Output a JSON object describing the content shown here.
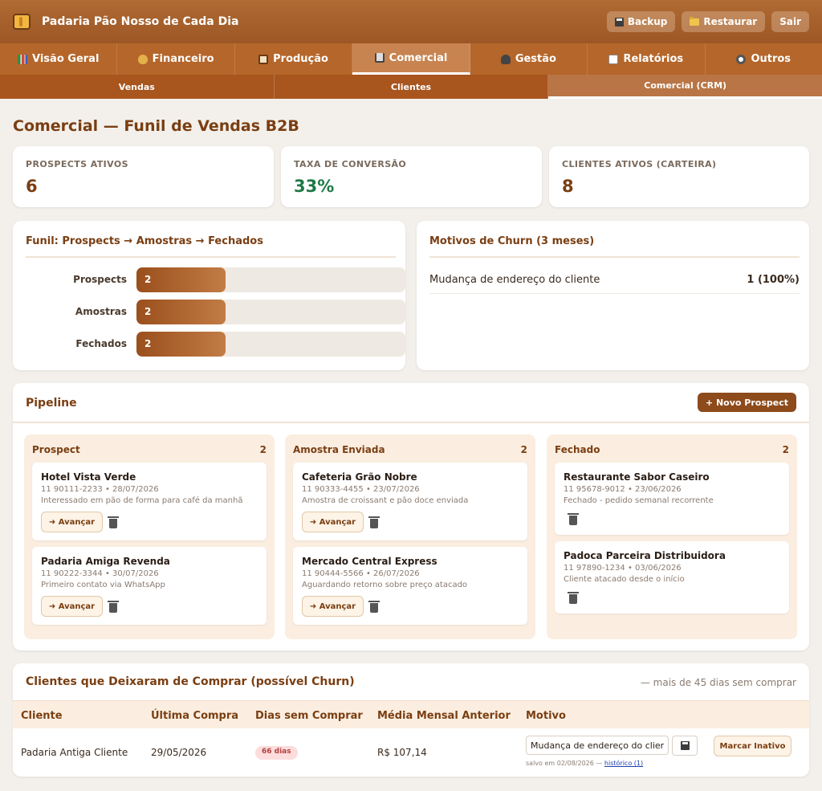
{
  "app": {
    "title": "Padaria Pão Nosso de Cada Dia",
    "actions": {
      "backup": "Backup",
      "restore": "Restaurar",
      "logout": "Sair"
    }
  },
  "main_tabs": [
    {
      "label": "Visão Geral",
      "icon": "chart-icon"
    },
    {
      "label": "Financeiro",
      "icon": "money-bag-icon"
    },
    {
      "label": "Produção",
      "icon": "clipboard-icon"
    },
    {
      "label": "Comercial",
      "icon": "cart-icon",
      "active": true
    },
    {
      "label": "Gestão",
      "icon": "people-icon"
    },
    {
      "label": "Relatórios",
      "icon": "report-icon"
    },
    {
      "label": "Outros",
      "icon": "gear-icon"
    }
  ],
  "sub_tabs": [
    {
      "label": "Vendas"
    },
    {
      "label": "Clientes"
    },
    {
      "label": "Comercial (CRM)",
      "active": true
    }
  ],
  "page": {
    "title": "Comercial — Funil de Vendas B2B"
  },
  "kpis": [
    {
      "label": "PROSPECTS ATIVOS",
      "value": "6"
    },
    {
      "label": "TAXA DE CONVERSÃO",
      "value": "33%"
    },
    {
      "label": "CLIENTES ATIVOS (CARTEIRA)",
      "value": "8"
    }
  ],
  "funnel": {
    "title": "Funil: Prospects → Amostras → Fechados",
    "stages": [
      {
        "label": "Prospects",
        "value": "2",
        "fraction": 0.33
      },
      {
        "label": "Amostras",
        "value": "2",
        "fraction": 0.33
      },
      {
        "label": "Fechados",
        "value": "2",
        "fraction": 0.33
      }
    ]
  },
  "churn_reasons": {
    "title": "Motivos de Churn (3 meses)",
    "items": [
      {
        "reason": "Mudança de endereço do cliente",
        "count": "1 (100%)"
      }
    ]
  },
  "pipeline": {
    "title": "Pipeline",
    "new_button": "+ Novo Prospect",
    "advance_label": "➜ Avançar",
    "columns": [
      {
        "title": "Prospect",
        "count": "2",
        "deals": [
          {
            "name": "Hotel Vista Verde",
            "meta": "11 90111-2233 • 28/07/2026",
            "note": "Interessado em pão de forma para café da manhã"
          },
          {
            "name": "Padaria Amiga Revenda",
            "meta": "11 90222-3344 • 30/07/2026",
            "note": "Primeiro contato via WhatsApp"
          }
        ]
      },
      {
        "title": "Amostra Enviada",
        "count": "2",
        "deals": [
          {
            "name": "Cafeteria Grão Nobre",
            "meta": "11 90333-4455 • 23/07/2026",
            "note": "Amostra de croissant e pão doce enviada"
          },
          {
            "name": "Mercado Central Express",
            "meta": "11 90444-5566 • 26/07/2026",
            "note": "Aguardando retorno sobre preço atacado"
          }
        ]
      },
      {
        "title": "Fechado",
        "count": "2",
        "deals": [
          {
            "name": "Restaurante Sabor Caseiro",
            "meta": "11 95678-9012 • 23/06/2026",
            "note": "Fechado - pedido semanal recorrente"
          },
          {
            "name": "Padoca Parceira Distribuidora",
            "meta": "11 97890-1234 • 03/06/2026",
            "note": "Cliente atacado desde o início"
          }
        ]
      }
    ]
  },
  "churn_table": {
    "title": "Clientes que Deixaram de Comprar (possível Churn)",
    "subtitle": "— mais de 45 dias sem comprar",
    "headers": [
      "Cliente",
      "Última Compra",
      "Dias sem Comprar",
      "Média Mensal Anterior",
      "Motivo"
    ],
    "rows": [
      {
        "client": "Padaria Antiga Cliente",
        "last_purchase": "29/05/2026",
        "days": "66 dias",
        "avg": "R$ 107,14",
        "reason_value": "Mudança de endereço do cliente",
        "saved_note": "salvo em 02/08/2026 —",
        "history_link": "histórico (1)",
        "inactive_button": "Marcar Inativo"
      }
    ]
  },
  "colors": {
    "brand": "#a8551e",
    "accent_dark": "#7a3e12",
    "success": "#1f7a45",
    "danger_badge": "#fcdcdc"
  }
}
